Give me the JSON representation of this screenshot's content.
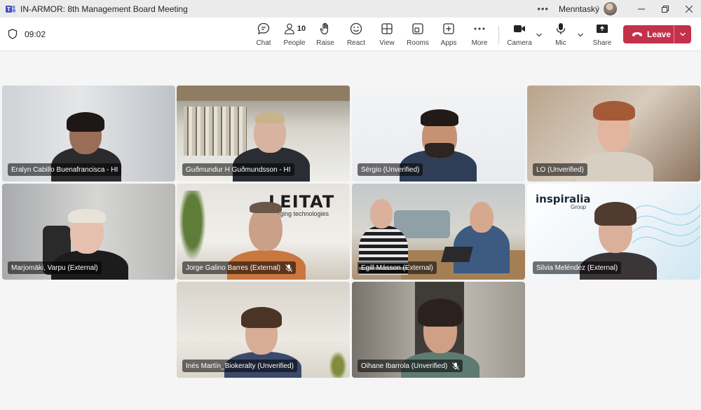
{
  "window": {
    "title": "IN-ARMOR: 8th Management Board Meeting",
    "user_name": "Menntaský"
  },
  "toolbar": {
    "timer": "09:02",
    "chat_label": "Chat",
    "people_label": "People",
    "people_count": "10",
    "raise_label": "Raise",
    "react_label": "React",
    "view_label": "View",
    "rooms_label": "Rooms",
    "apps_label": "Apps",
    "more_label": "More",
    "camera_label": "Camera",
    "mic_label": "Mic",
    "share_label": "Share",
    "leave_label": "Leave"
  },
  "tiles": [
    {
      "name": "Eralyn Cabillo Buenafrancisca - HI"
    },
    {
      "name": "Guðmundur H Guðmundsson - HI"
    },
    {
      "name": "Sérgio (Unverified)"
    },
    {
      "name": "LO (Unverified)"
    },
    {
      "name": "Marjomäki, Varpu (External)"
    },
    {
      "name": "Jorge Galino Barres (External)"
    },
    {
      "name": "Egill Másson (External)"
    },
    {
      "name": "Silvia Meléndez (External)"
    },
    {
      "name": "Inés Martín_Biokeralty (Unverified)"
    },
    {
      "name": "Oihane Ibarrola (Unverified)"
    }
  ],
  "logos": {
    "leitat": "LEITAT",
    "leitat_sub": "aging technologies",
    "inspiralia": "inspiralia",
    "inspiralia_sub": "Group"
  },
  "colors": {
    "leave": "#c4314b",
    "titlebar": "#ebebeb",
    "stage": "#f5f5f5"
  }
}
